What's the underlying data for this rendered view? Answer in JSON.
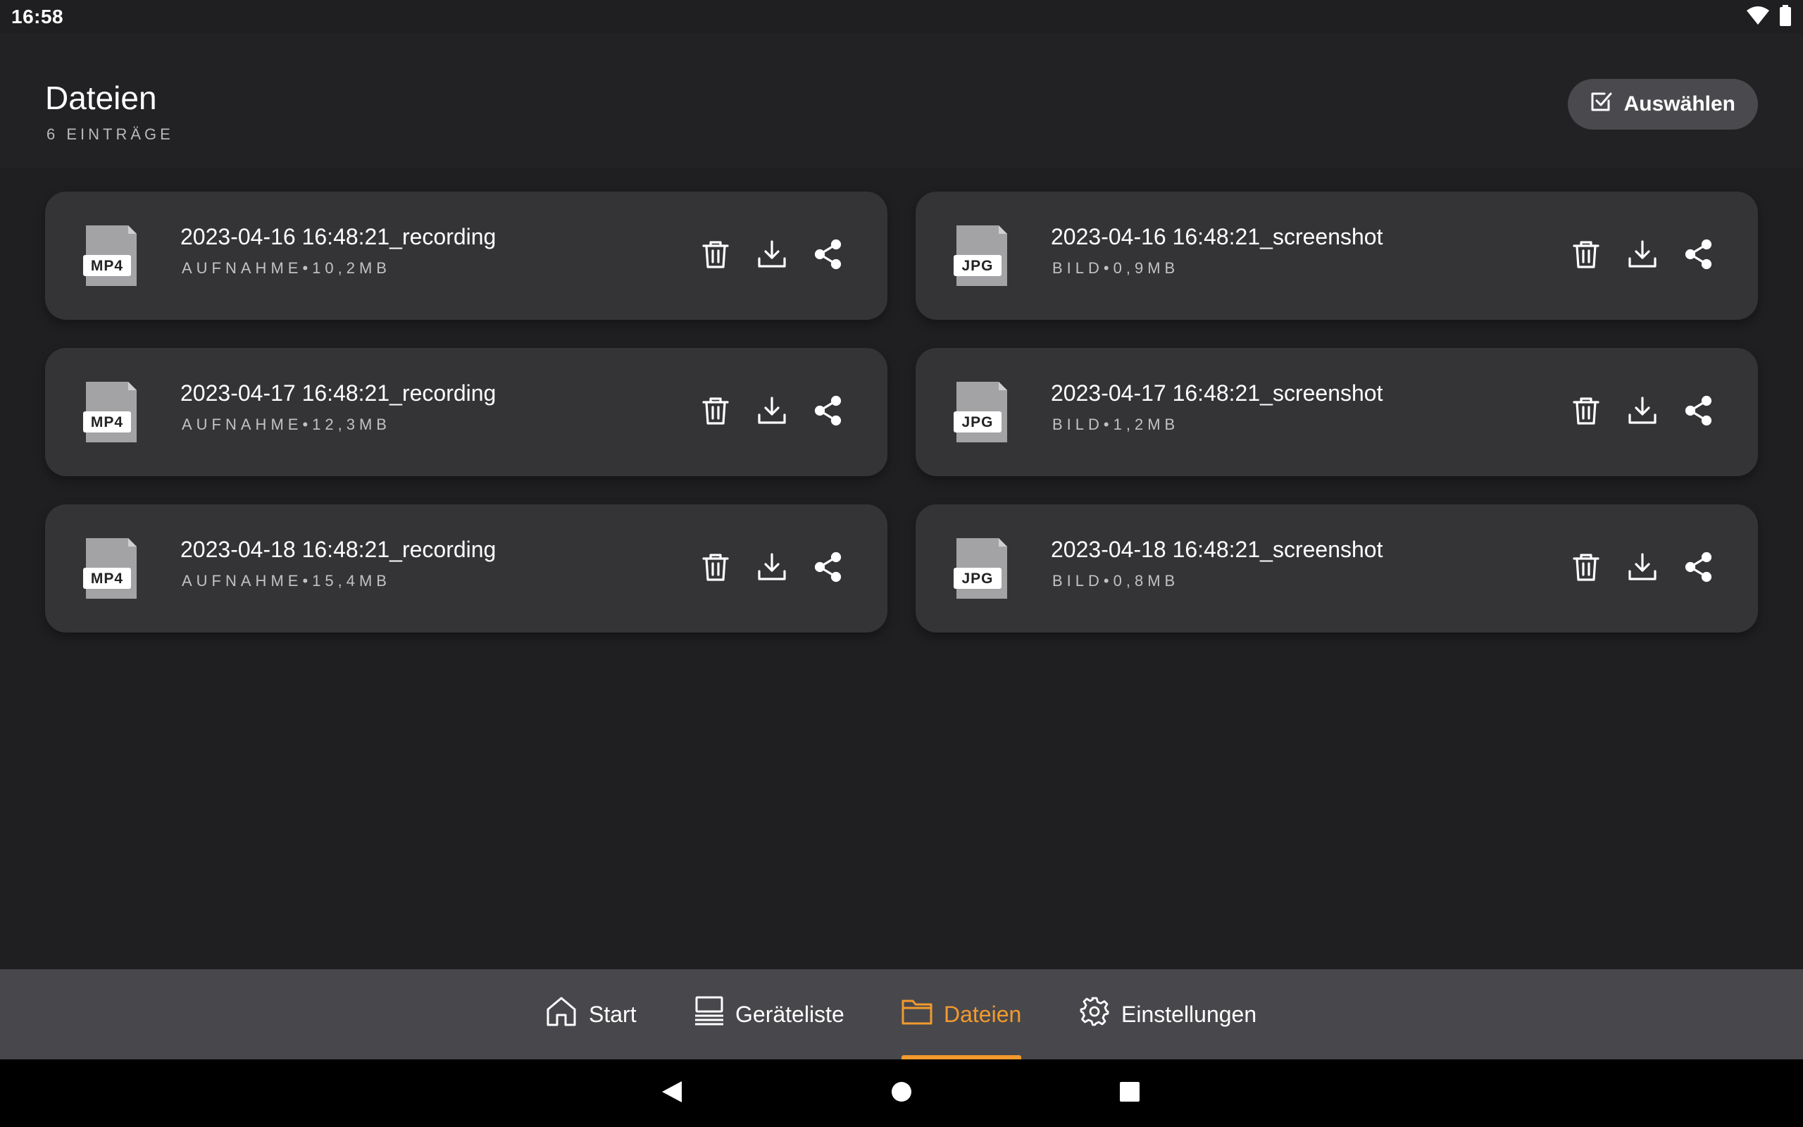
{
  "status_bar": {
    "time": "16:58",
    "icons": [
      "wifi-icon",
      "battery-icon"
    ]
  },
  "header": {
    "title": "Dateien",
    "subtitle": "6 EINTRÄGE",
    "select_button_label": "Auswählen"
  },
  "files": [
    {
      "badge": "MP4",
      "name": "2023-04-16 16:48:21_recording",
      "meta": "AUFNAHME•10,2MB"
    },
    {
      "badge": "JPG",
      "name": "2023-04-16 16:48:21_screenshot",
      "meta": "BILD•0,9MB"
    },
    {
      "badge": "MP4",
      "name": "2023-04-17 16:48:21_recording",
      "meta": "AUFNAHME•12,3MB"
    },
    {
      "badge": "JPG",
      "name": "2023-04-17 16:48:21_screenshot",
      "meta": "BILD•1,2MB"
    },
    {
      "badge": "MP4",
      "name": "2023-04-18 16:48:21_recording",
      "meta": "AUFNAHME•15,4MB"
    },
    {
      "badge": "JPG",
      "name": "2023-04-18 16:48:21_screenshot",
      "meta": "BILD•0,8MB"
    }
  ],
  "bottom_nav": {
    "items": [
      {
        "label": "Start",
        "icon": "home-icon"
      },
      {
        "label": "Geräteliste",
        "icon": "device-list-icon"
      },
      {
        "label": "Dateien",
        "icon": "folder-icon",
        "active": true
      },
      {
        "label": "Einstellungen",
        "icon": "gear-icon"
      }
    ]
  },
  "colors": {
    "accent": "#f29a2e",
    "background": "#1f1f21",
    "card": "#343437",
    "nav": "#48484c"
  }
}
